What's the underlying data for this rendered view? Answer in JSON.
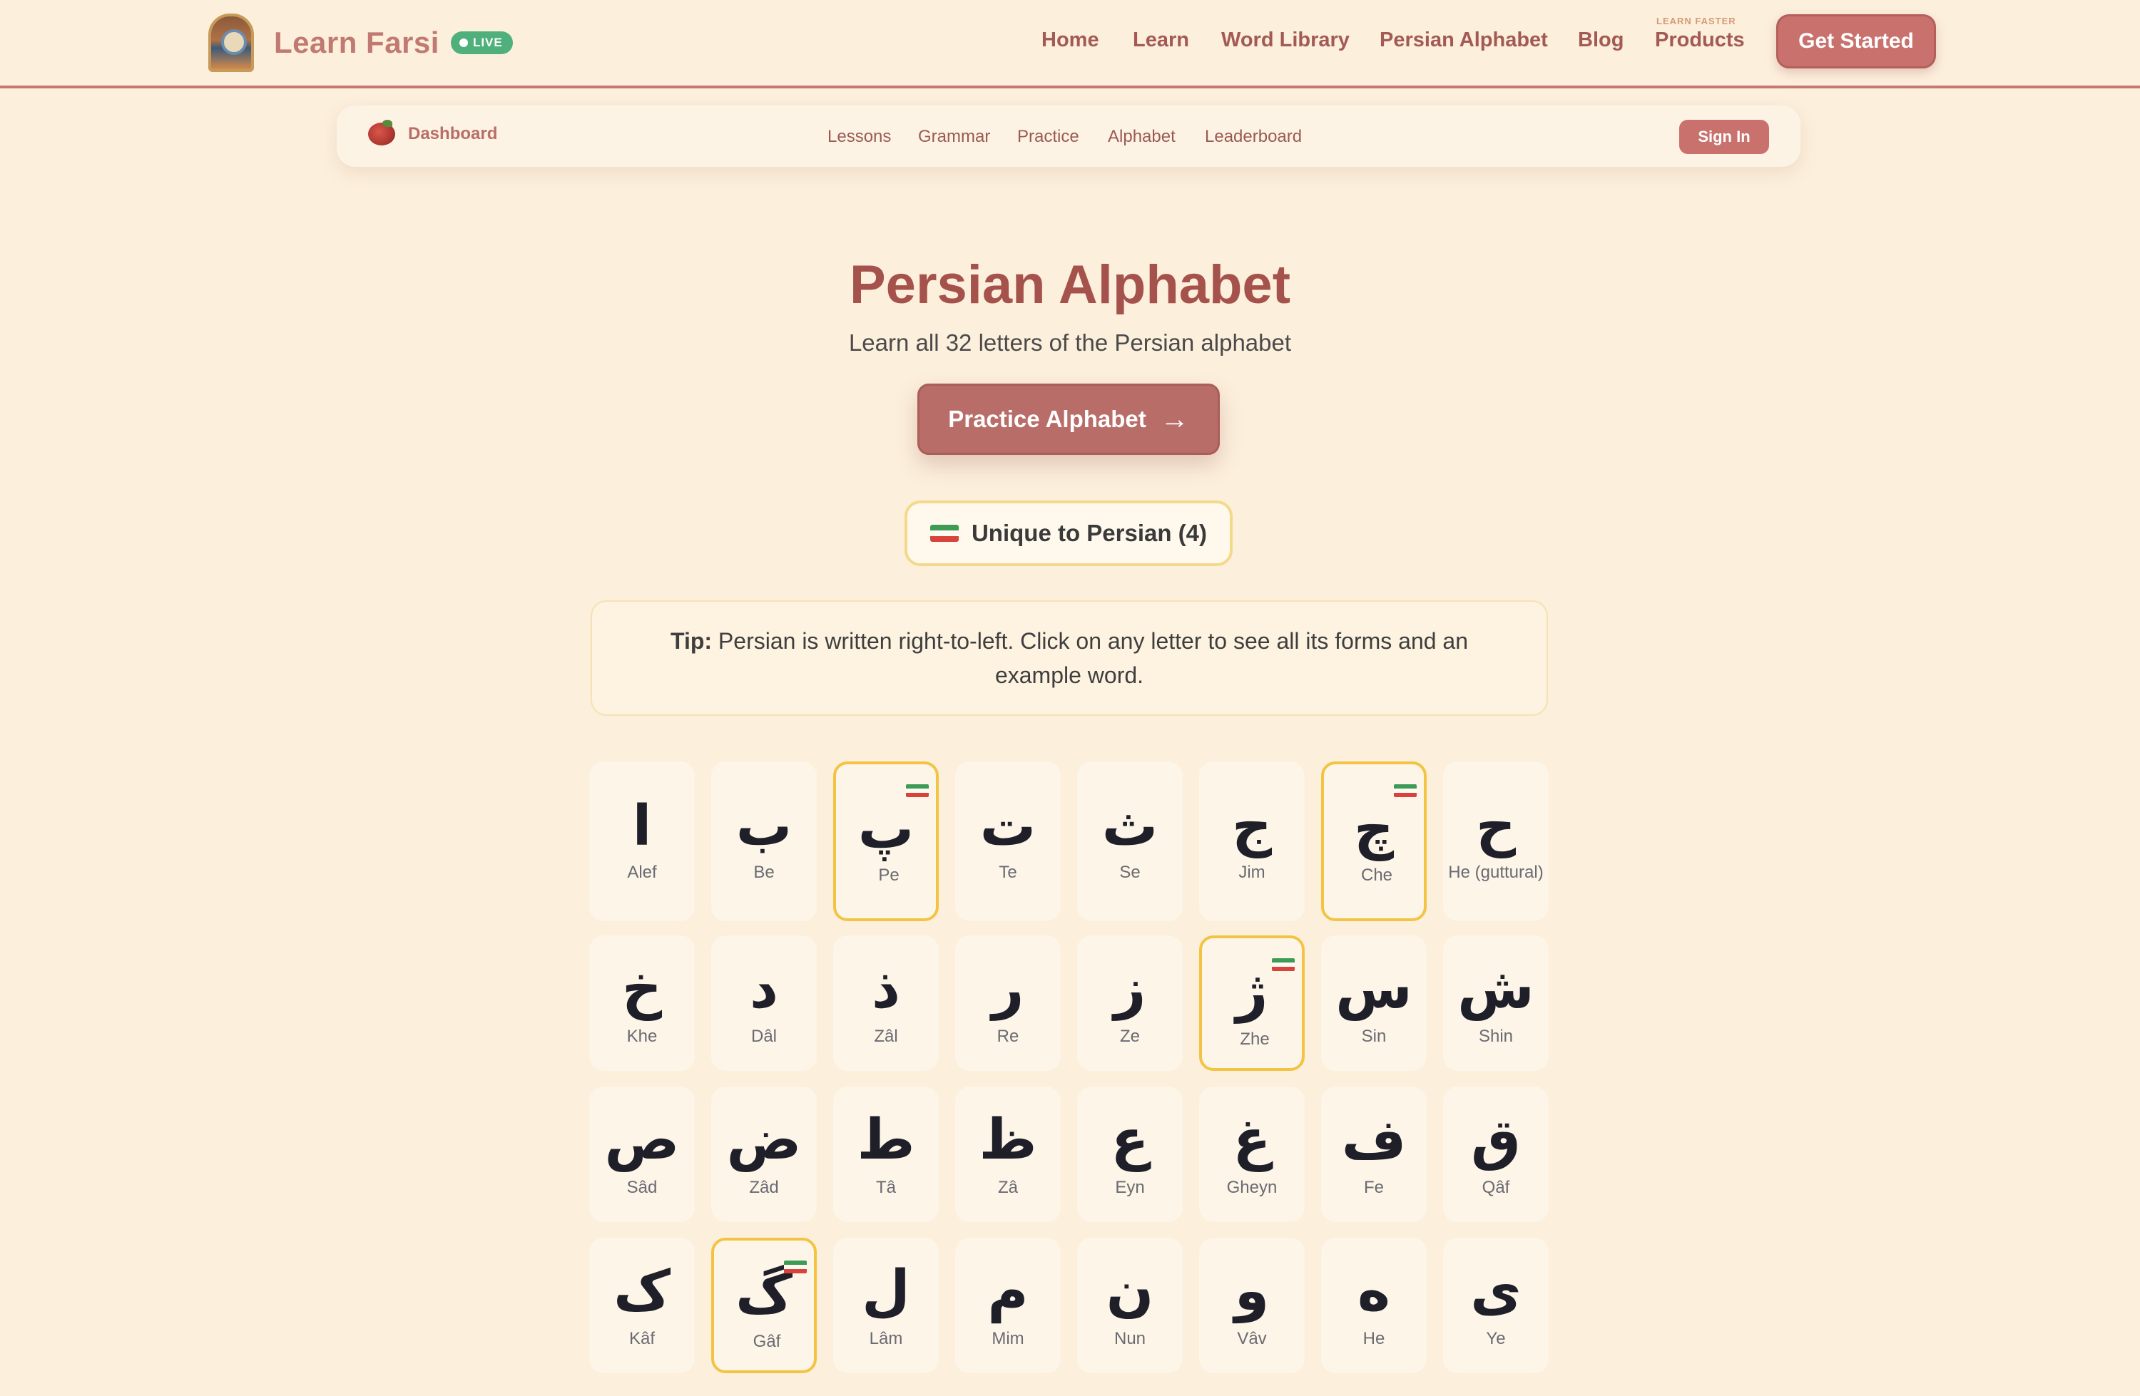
{
  "header": {
    "brand": "Learn Farsi",
    "live_badge": "LIVE",
    "nav": {
      "home": "Home",
      "learn": "Learn",
      "word_library": "Word Library",
      "persian_alphabet": "Persian Alphabet",
      "blog": "Blog",
      "products_tag": "LEARN FASTER",
      "products": "Products"
    },
    "cta": "Get Started"
  },
  "subnav": {
    "dashboard": "Dashboard",
    "links": {
      "lessons": "Lessons",
      "grammar": "Grammar",
      "practice": "Practice",
      "alphabet": "Alphabet",
      "leaderboard": "Leaderboard"
    },
    "signin": "Sign In"
  },
  "hero": {
    "title": "Persian Alphabet",
    "subtitle": "Learn all 32 letters of the Persian alphabet",
    "practice_button": "Practice Alphabet",
    "unique_filter": "Unique to Persian (4)"
  },
  "tip": {
    "label": "Tip:",
    "text": "Persian is written right-to-left. Click on any letter to see all its forms and an example word."
  },
  "colors": {
    "unique_border": "#f3c444",
    "accent": "#c9726d",
    "flag": [
      "#3e9b55",
      "#fffaf1",
      "#d8443c"
    ]
  },
  "letters": [
    {
      "char": "ا",
      "name": "Alef",
      "unique": false
    },
    {
      "char": "ب",
      "name": "Be",
      "unique": false
    },
    {
      "char": "پ",
      "name": "Pe",
      "unique": true
    },
    {
      "char": "ت",
      "name": "Te",
      "unique": false
    },
    {
      "char": "ث",
      "name": "Se",
      "unique": false
    },
    {
      "char": "ج",
      "name": "Jim",
      "unique": false
    },
    {
      "char": "چ",
      "name": "Che",
      "unique": true
    },
    {
      "char": "ح",
      "name": "He (guttural)",
      "unique": false
    },
    {
      "char": "خ",
      "name": "Khe",
      "unique": false
    },
    {
      "char": "د",
      "name": "Dâl",
      "unique": false
    },
    {
      "char": "ذ",
      "name": "Zâl",
      "unique": false
    },
    {
      "char": "ر",
      "name": "Re",
      "unique": false
    },
    {
      "char": "ز",
      "name": "Ze",
      "unique": false
    },
    {
      "char": "ژ",
      "name": "Zhe",
      "unique": true
    },
    {
      "char": "س",
      "name": "Sin",
      "unique": false
    },
    {
      "char": "ش",
      "name": "Shin",
      "unique": false
    },
    {
      "char": "ص",
      "name": "Sâd",
      "unique": false
    },
    {
      "char": "ض",
      "name": "Zâd",
      "unique": false
    },
    {
      "char": "ط",
      "name": "Tâ",
      "unique": false
    },
    {
      "char": "ظ",
      "name": "Zâ",
      "unique": false
    },
    {
      "char": "ع",
      "name": "Eyn",
      "unique": false
    },
    {
      "char": "غ",
      "name": "Gheyn",
      "unique": false
    },
    {
      "char": "ف",
      "name": "Fe",
      "unique": false
    },
    {
      "char": "ق",
      "name": "Qâf",
      "unique": false
    },
    {
      "char": "ک",
      "name": "Kâf",
      "unique": false
    },
    {
      "char": "گ",
      "name": "Gâf",
      "unique": true
    },
    {
      "char": "ل",
      "name": "Lâm",
      "unique": false
    },
    {
      "char": "م",
      "name": "Mim",
      "unique": false
    },
    {
      "char": "ن",
      "name": "Nun",
      "unique": false
    },
    {
      "char": "و",
      "name": "Vâv",
      "unique": false
    },
    {
      "char": "ه",
      "name": "He",
      "unique": false
    },
    {
      "char": "ی",
      "name": "Ye",
      "unique": false
    }
  ]
}
